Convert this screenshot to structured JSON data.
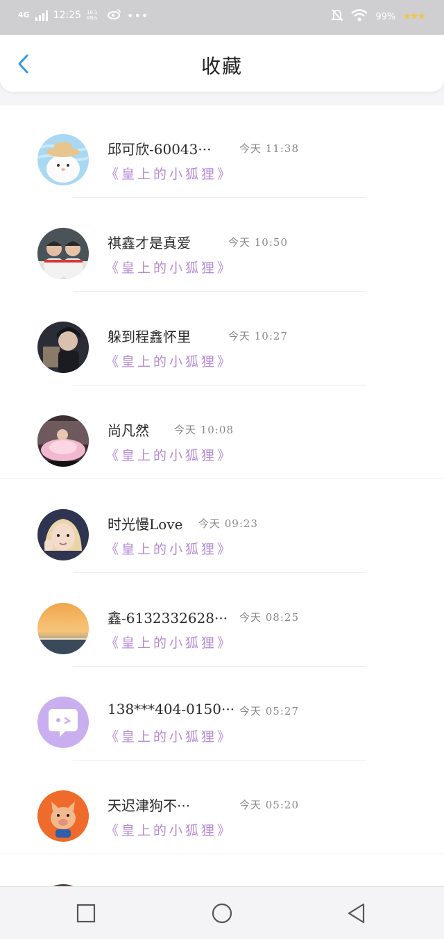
{
  "status_bar": {
    "network": "4G",
    "time": "12:25",
    "speed": "18.1 KB/s",
    "battery": "99%",
    "stars": "★★★"
  },
  "header": {
    "title": "收藏",
    "back_icon": "chevron-left-icon"
  },
  "items": [
    {
      "name": "邱可欣-60043···",
      "time": "今天 11:38",
      "subtitle": "《皇上的小狐狸》",
      "avatar": "bear-with-hat"
    },
    {
      "name": "祺鑫才是真爱",
      "time": "今天 10:50",
      "subtitle": "《皇上的小狐狸》",
      "avatar": "two-boys-photo"
    },
    {
      "name": "躲到程鑫怀里",
      "time": "今天 10:27",
      "subtitle": "《皇上的小狐狸》",
      "avatar": "dark-portrait-photo"
    },
    {
      "name": "尚凡然",
      "time": "今天 10:08",
      "subtitle": "《皇上的小狐狸》",
      "avatar": "pink-dress-photo"
    },
    {
      "name": "时光慢Love",
      "time": "今天 09:23",
      "subtitle": "《皇上的小狐狸》",
      "avatar": "girl-selfie-photo"
    },
    {
      "name": "鑫-6132332628···",
      "time": "今天 08:25",
      "subtitle": "《皇上的小狐狸》",
      "avatar": "sunset-landscape-photo"
    },
    {
      "name": "138***404-0150···",
      "time": "今天 05:27",
      "subtitle": "《皇上的小狐狸》",
      "avatar": "default-chat-bubble-avatar"
    },
    {
      "name": "天迟津狗不···",
      "time": "今天 05:20",
      "subtitle": "《皇上的小狐狸》",
      "avatar": "cartoon-pig-avatar"
    }
  ],
  "nav": {
    "recent_icon": "square-icon",
    "home_icon": "circle-icon",
    "back_icon": "triangle-back-icon"
  },
  "colors": {
    "accent_blue": "#2f9be6",
    "subtitle_purple": "#b58ad4",
    "statusbar_gray": "#cfcfd2"
  }
}
